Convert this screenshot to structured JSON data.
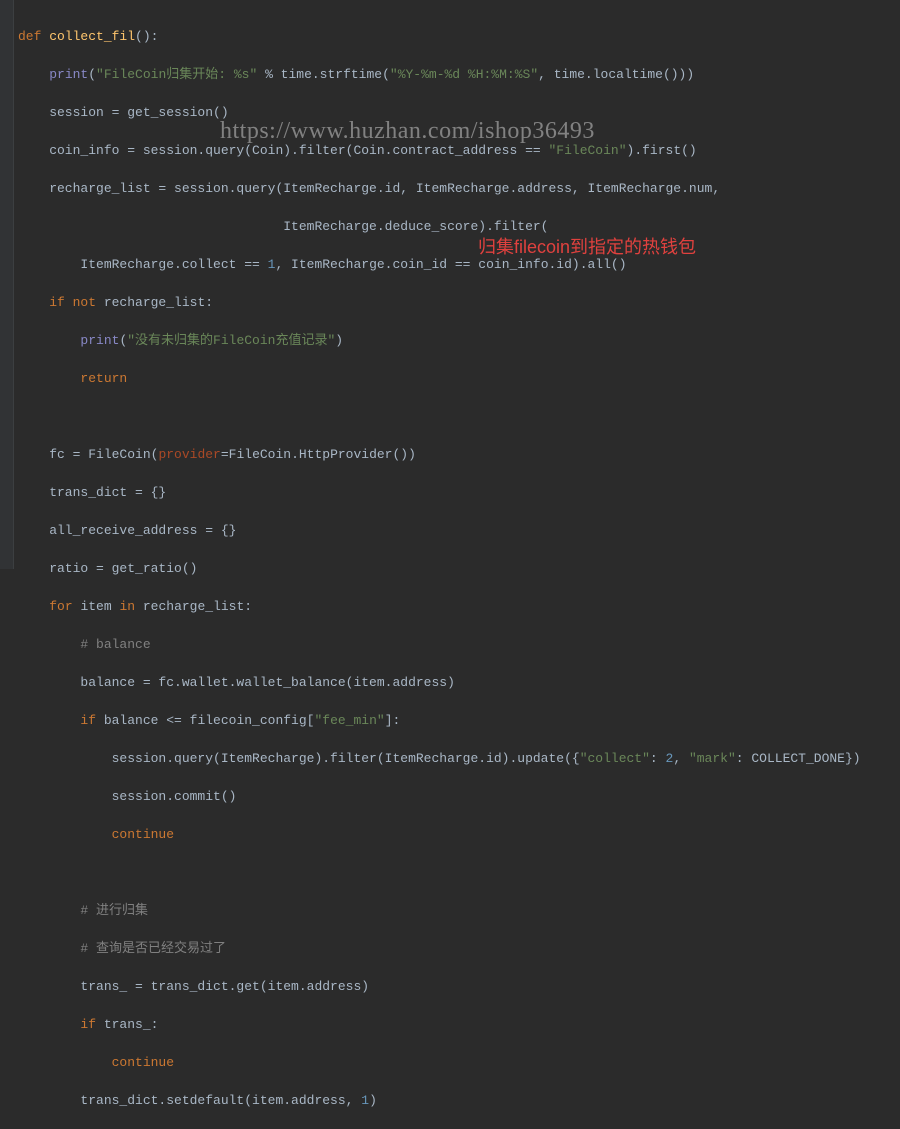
{
  "watermark": "https://www.huzhan.com/ishop36493",
  "annotation": "归集filecoin到指定的热钱包",
  "code": {
    "l1_def": "def ",
    "l1_fn": "collect_fil",
    "l1_rest": "():",
    "l2_print": "print",
    "l2_s1": "\"FileCoin归集开始: %s\"",
    "l2_pct": " % time.strftime(",
    "l2_fmt": "\"%Y-%m-%d %H:%M:%S\"",
    "l2_end": ", time.localtime()))",
    "l3": "    session = get_session()",
    "l4a": "    coin_info = session.query(Coin).filter(Coin.contract_address == ",
    "l4s": "\"FileCoin\"",
    "l4b": ").first()",
    "l5": "    recharge_list = session.query(ItemRecharge.id, ItemRecharge.address, ItemRecharge.num,",
    "l6": "                                  ItemRecharge.deduce_score).filter(",
    "l7a": "        ItemRecharge.collect == ",
    "l7n1": "1",
    "l7b": ", ItemRecharge.coin_id == coin_info.id).all()",
    "l8_if": "if not ",
    "l8_rest": "recharge_list:",
    "l9_pr": "print",
    "l9_s": "\"没有未归集的FileCoin充值记录\"",
    "l10_ret": "return",
    "l12a": "    fc = FileCoin(",
    "l12p": "provider",
    "l12b": "=FileCoin.HttpProvider())",
    "l13": "    trans_dict = {}",
    "l14": "    all_receive_address = {}",
    "l15": "    ratio = get_ratio()",
    "l16_for": "for ",
    "l16_item": "item ",
    "l16_in": "in ",
    "l16_rest": "recharge_list:",
    "l17_c": "# balance",
    "l18": "        balance = fc.wallet.wallet_balance(item.address)",
    "l19_if": "if ",
    "l19a": "balance <= filecoin_config[",
    "l19s": "\"fee_min\"",
    "l19b": "]:",
    "l20a": "            session.query(ItemRecharge).filter(ItemRecharge.id).update({",
    "l20s1": "\"collect\"",
    "l20mid": ": ",
    "l20n": "2",
    "l20mid2": ", ",
    "l20s2": "\"mark\"",
    "l20end": ": COLLECT_DONE})",
    "l21": "            session.commit()",
    "l22_cont": "continue",
    "l24_c": "# 进行归集",
    "l25_c": "# 查询是否已经交易过了",
    "l26": "        trans_ = trans_dict.get(item.address)",
    "l27_if": "if ",
    "l27_rest": "trans_:",
    "l28_cont": "continue",
    "l29a": "        trans_dict.setdefault(item.address, ",
    "l29n": "1",
    "l29b": ")"
  }
}
